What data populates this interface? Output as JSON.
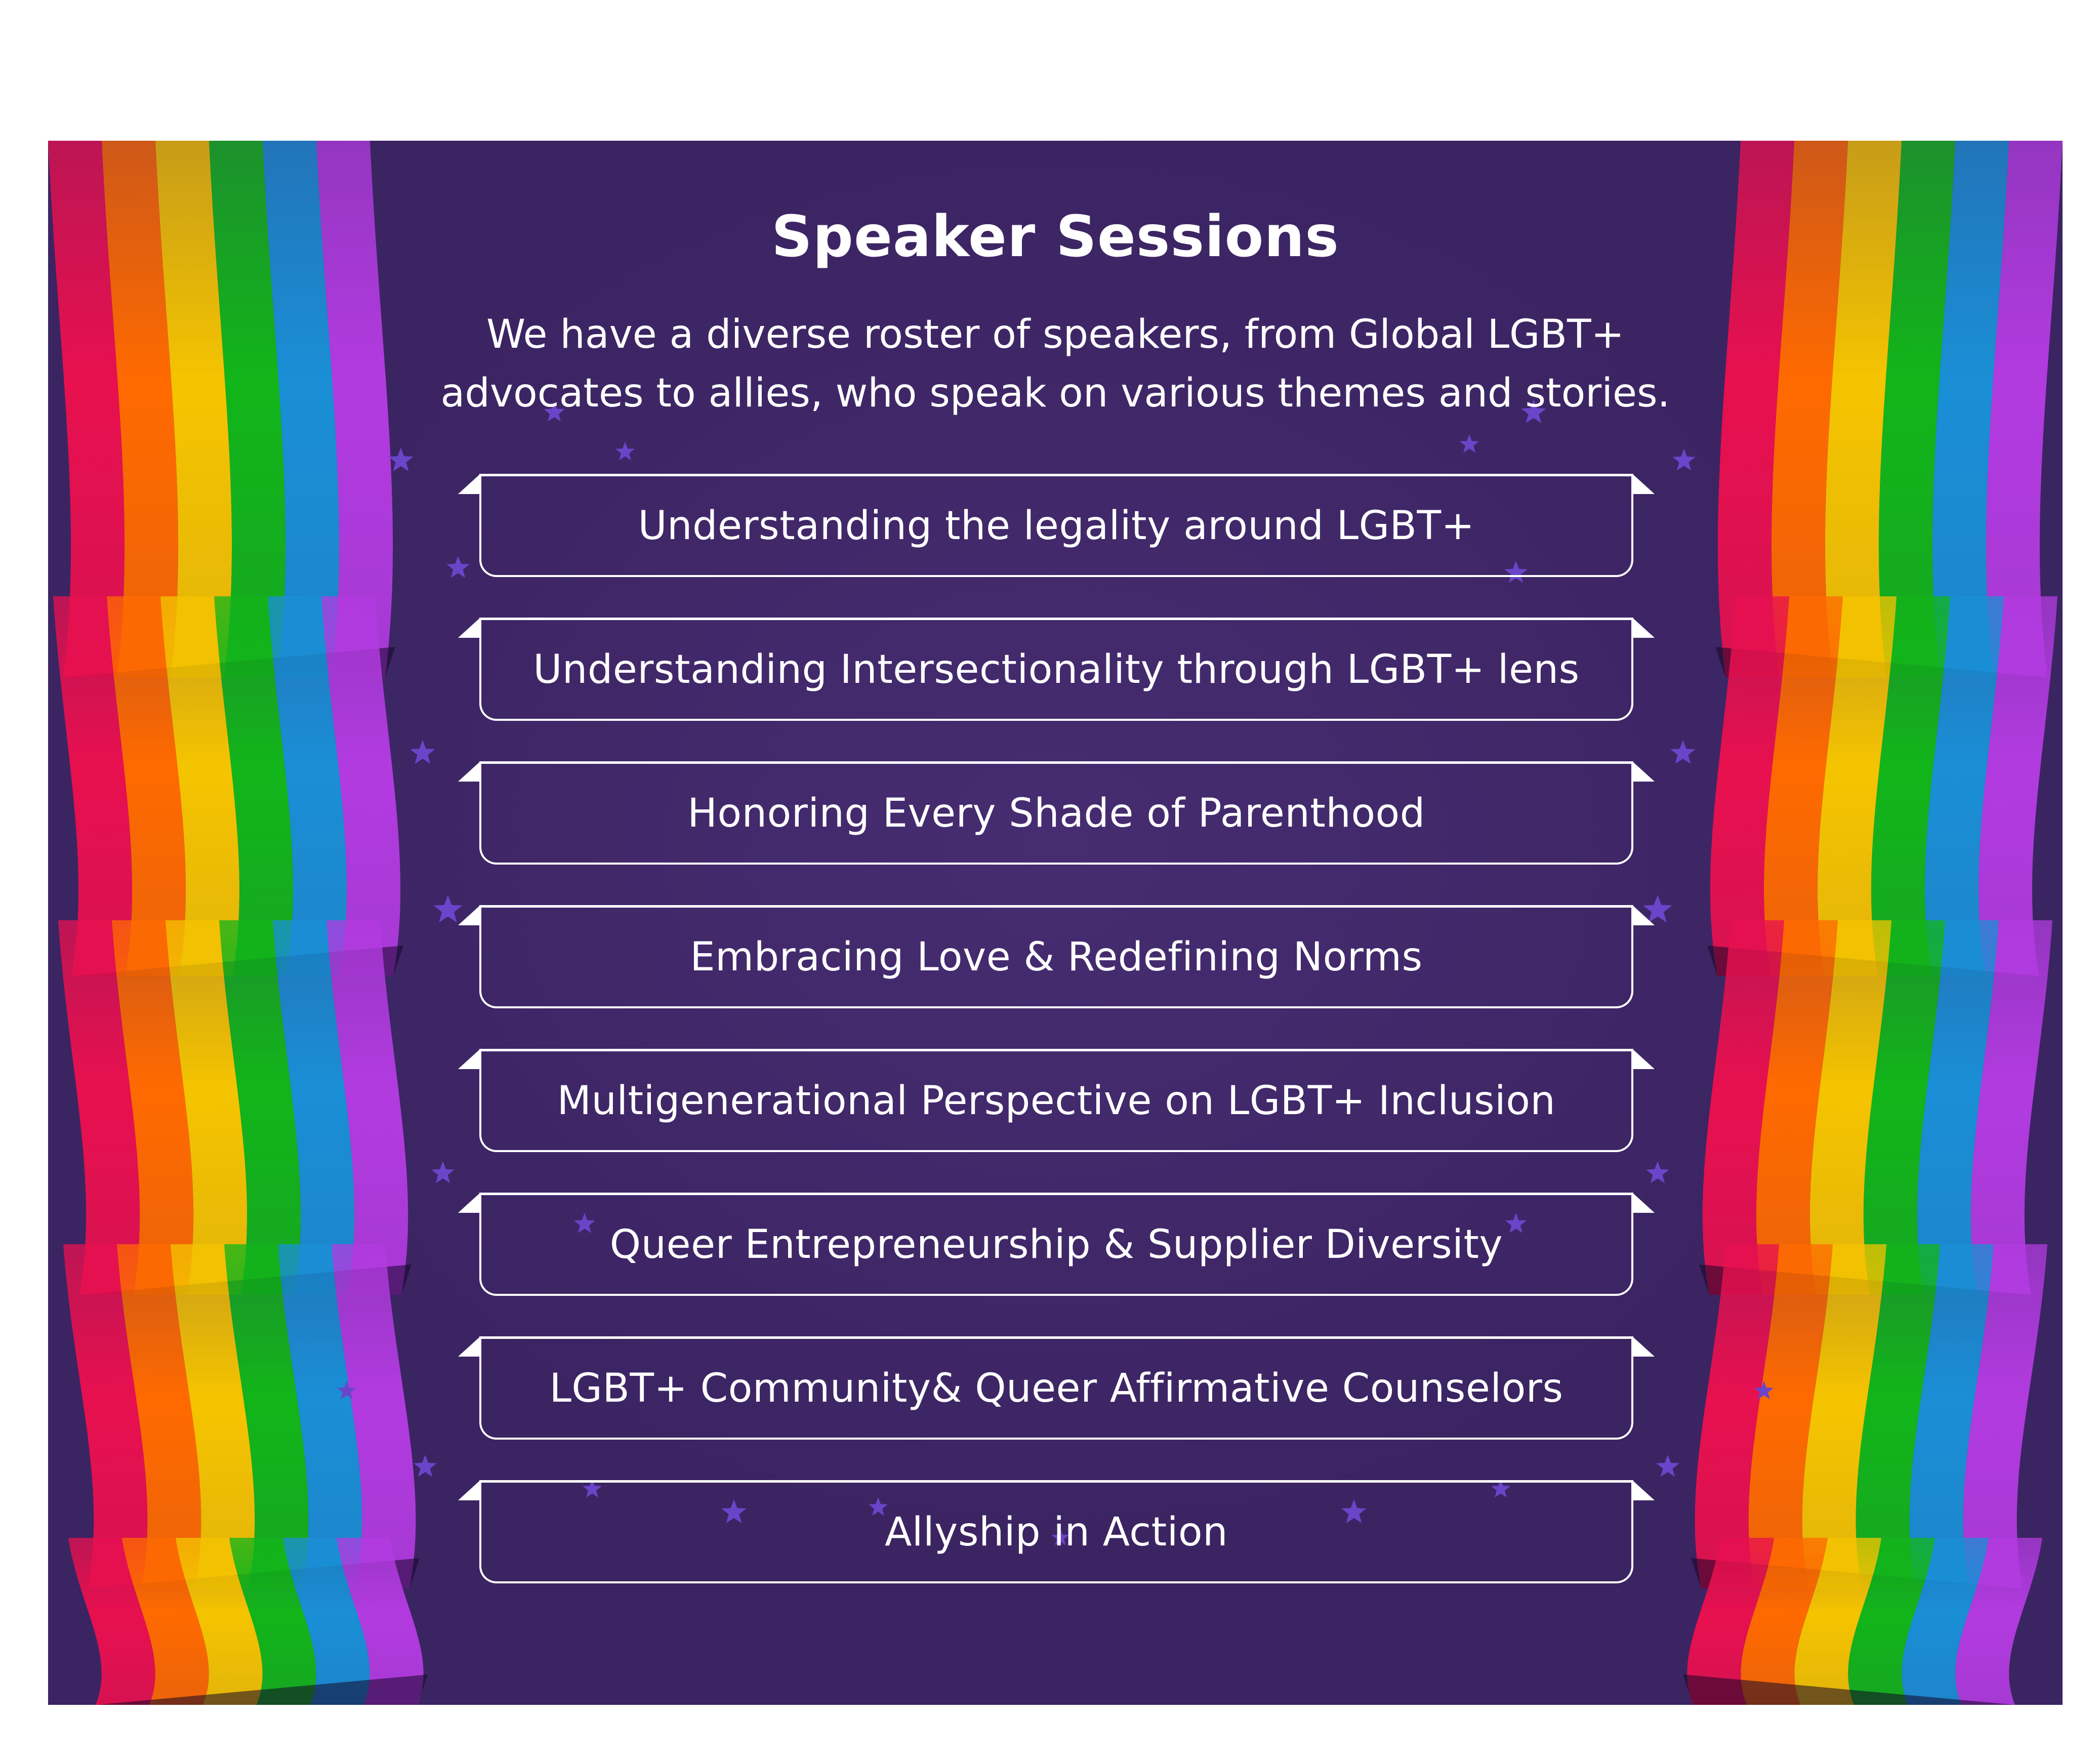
{
  "poster": {
    "title": "Speaker Sessions",
    "subtitle_lines": [
      "We have a diverse roster of speakers, from Global LGBT+",
      "advocates to allies, who speak on various themes and stories."
    ],
    "sessions": [
      "Understanding the legality around LGBT+",
      "Understanding Intersectionality through LGBT+ lens",
      "Honoring Every Shade of Parenthood",
      "Embracing Love & Redefining Norms",
      "Multigenerational Perspective on LGBT+ Inclusion",
      "Queer Entrepreneurship & Supplier Diversity",
      "LGBT+ Community& Queer Affirmative Counselors",
      "Allyship in Action"
    ]
  },
  "colors": {
    "background": "#3b2462",
    "text": "#ffffff",
    "star": "#6a45c9",
    "rainbow": [
      "#e8104f",
      "#ff6a00",
      "#f5c400",
      "#12b51a",
      "#1a8fd6",
      "#b23be0"
    ]
  },
  "icons": {
    "decorative_stars": "star-icon",
    "side_decor": "rainbow-ribbon"
  }
}
